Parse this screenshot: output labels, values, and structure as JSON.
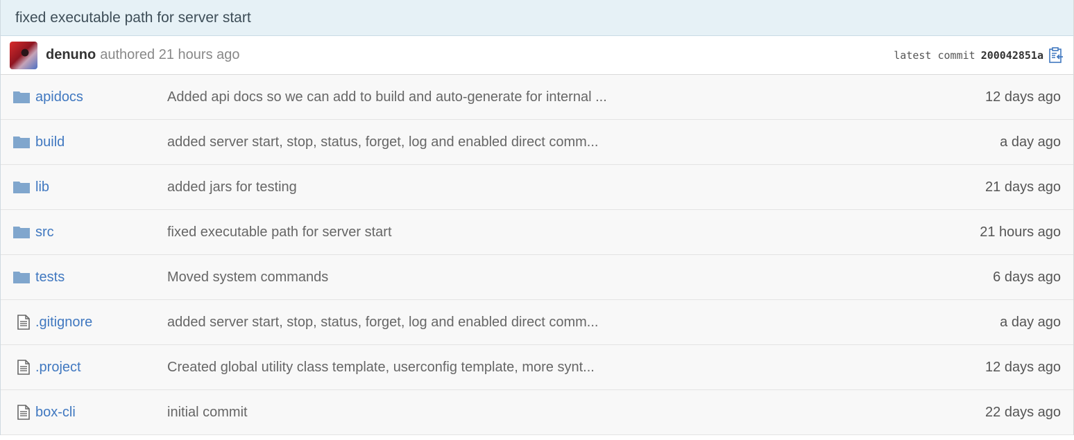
{
  "commit": {
    "title": "fixed executable path for server start",
    "author": "denuno",
    "authored_text": "authored 21 hours ago",
    "latest_label": "latest commit",
    "sha": "200042851a"
  },
  "colors": {
    "link": "#4078c0",
    "folder": "#80a6cd",
    "header_bg": "#e6f1f6"
  },
  "files": [
    {
      "type": "folder",
      "icon": "folder-icon",
      "name": "apidocs",
      "message": "Added api docs so we can add to build and auto-generate for internal ...",
      "age": "12 days ago"
    },
    {
      "type": "folder",
      "icon": "folder-icon",
      "name": "build",
      "message": "added server start, stop, status, forget, log and enabled direct comm...",
      "age": "a day ago"
    },
    {
      "type": "folder",
      "icon": "folder-icon",
      "name": "lib",
      "message": "added jars for testing",
      "age": "21 days ago"
    },
    {
      "type": "folder",
      "icon": "folder-icon",
      "name": "src",
      "message": "fixed executable path for server start",
      "age": "21 hours ago"
    },
    {
      "type": "folder",
      "icon": "folder-icon",
      "name": "tests",
      "message": "Moved system commands",
      "age": "6 days ago"
    },
    {
      "type": "file",
      "icon": "file-icon",
      "name": ".gitignore",
      "message": "added server start, stop, status, forget, log and enabled direct comm...",
      "age": "a day ago"
    },
    {
      "type": "file",
      "icon": "file-icon",
      "name": ".project",
      "message": "Created global utility class template, userconfig template, more synt...",
      "age": "12 days ago"
    },
    {
      "type": "file",
      "icon": "file-icon",
      "name": "box-cli",
      "message": "initial commit",
      "age": "22 days ago"
    }
  ]
}
